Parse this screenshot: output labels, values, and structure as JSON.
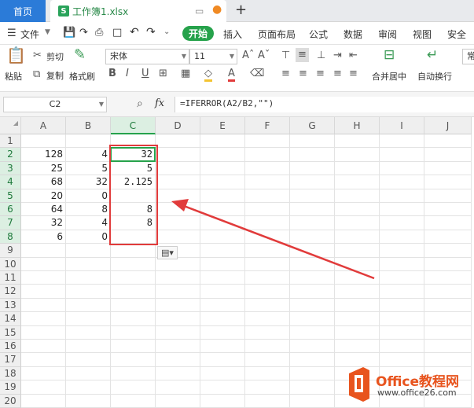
{
  "tabs": {
    "home": "首页",
    "doc_title": "工作簿1.xlsx",
    "s_icon": "S",
    "new_tab": "+"
  },
  "menu": {
    "file": "文件",
    "items": [
      "开始",
      "插入",
      "页面布局",
      "公式",
      "数据",
      "审阅",
      "视图",
      "安全"
    ]
  },
  "ribbon": {
    "paste": "粘贴",
    "cut": "剪切",
    "copy": "复制",
    "format_painter": "格式刷",
    "font_name": "宋体",
    "font_size": "11",
    "merge_center": "合并居中",
    "wrap_text": "自动换行",
    "normal": "常"
  },
  "formula_bar": {
    "name_box": "C2",
    "fx": "fx",
    "formula": "=IFERROR(A2/B2,\"\")"
  },
  "grid": {
    "columns": [
      "A",
      "B",
      "C",
      "D",
      "E",
      "F",
      "G",
      "H",
      "I",
      "J"
    ],
    "rows": [
      "1",
      "2",
      "3",
      "4",
      "5",
      "6",
      "7",
      "8",
      "9",
      "10",
      "11",
      "12",
      "13",
      "14",
      "15",
      "16",
      "17",
      "18",
      "19",
      "20"
    ],
    "data": [
      {
        "a": "",
        "b": "",
        "c": ""
      },
      {
        "a": "128",
        "b": "4",
        "c": "32"
      },
      {
        "a": "25",
        "b": "5",
        "c": "5"
      },
      {
        "a": "68",
        "b": "32",
        "c": "2.125"
      },
      {
        "a": "20",
        "b": "0",
        "c": ""
      },
      {
        "a": "64",
        "b": "8",
        "c": "8"
      },
      {
        "a": "32",
        "b": "4",
        "c": "8"
      },
      {
        "a": "6",
        "b": "0",
        "c": ""
      }
    ]
  },
  "watermark": {
    "brand": "Office教程网",
    "url": "www.office26.com"
  },
  "colors": {
    "accent": "#26a24b",
    "annotation": "#e13b3b",
    "tab_blue": "#2b7bd8",
    "logo_orange": "#e8541e"
  }
}
